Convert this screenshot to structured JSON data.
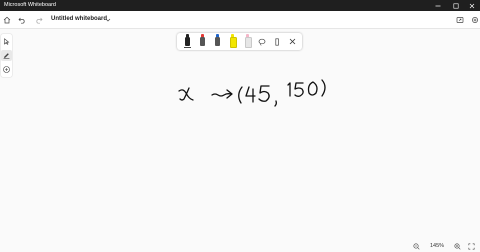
{
  "titlebar": {
    "app_name": "Microsoft Whiteboard"
  },
  "toolbar": {
    "doc_title": "Untitled whiteboard"
  },
  "ink_toolbar": {
    "pens": [
      {
        "name": "black-pen",
        "color": "#222222"
      },
      {
        "name": "red-pen",
        "color": "#e53935"
      },
      {
        "name": "blue-pen",
        "color": "#1e63c8"
      },
      {
        "name": "yellow-highlighter",
        "color": "#f2e600"
      },
      {
        "name": "eraser",
        "color": "#f4b6c8"
      }
    ]
  },
  "zoom": {
    "level": "145%"
  }
}
